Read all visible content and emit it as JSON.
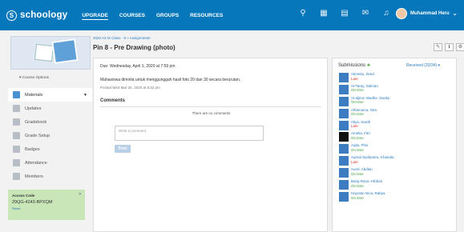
{
  "header": {
    "logo_text": "schoology",
    "logo_mark": "S",
    "nav": [
      "UPGRADE",
      "COURSES",
      "GROUPS",
      "RESOURCES"
    ],
    "icons": [
      "search-icon",
      "apps-grid-icon",
      "calendar-icon",
      "mail-icon",
      "bell-icon"
    ],
    "user_name": "Muhammad Heru",
    "brand_color": "#0677ba"
  },
  "sidebar": {
    "course_options": "▾ Course Options",
    "items": [
      {
        "label": "Materials",
        "icon": "materials-icon",
        "selected": true
      },
      {
        "label": "Updates",
        "icon": "updates-icon"
      },
      {
        "label": "Gradebook",
        "icon": "gradebook-icon"
      },
      {
        "label": "Grade Setup",
        "icon": "grade-setup-icon"
      },
      {
        "label": "Badges",
        "icon": "badges-icon"
      },
      {
        "label": "Attendance",
        "icon": "attendance-icon"
      },
      {
        "label": "Members",
        "icon": "members-icon"
      }
    ],
    "access_code": {
      "title": "Access Code",
      "code": "29QG-4243-BPXQM",
      "reset": "Reset"
    }
  },
  "breadcrumb": "2020 A3 IX Class · 8 » Assignments",
  "page_title": "Pin 8 - Pre Drawing (photo)",
  "assignment": {
    "due": "Due: Wednesday, April 1, 2020 at 7:59 pm",
    "instructions": "Mahasiswa diminta untuk menggunggah hasil foto 20 dan 30 secara berurutan.",
    "posted": "Posted Wed Mar 25, 2020 at 8:42 pm",
    "comments_heading": "Comments",
    "no_comments": "There are no comments",
    "comment_placeholder": "Write a comment",
    "post_label": "Post"
  },
  "submissions": {
    "heading": "Submissions",
    "filter": "Received (20/34) ▾",
    "items": [
      {
        "name": "Akmelia, Zeed",
        "status": "Late",
        "late": true
      },
      {
        "name": "Al-Taray, Salman",
        "status": "On time",
        "late": false
      },
      {
        "name": "Al-aljirun Wudhe, Deaky",
        "status": "On time",
        "late": false
      },
      {
        "name": "Alhamuinu, Stra",
        "status": "On time",
        "late": false
      },
      {
        "name": "Aliya, Sarah",
        "status": "Late",
        "late": true
      },
      {
        "name": "Amelia, Fitri",
        "status": "On time",
        "late": false
      },
      {
        "name": "Aqila, Phis",
        "status": "On time",
        "late": false
      },
      {
        "name": "Aqmal Syahputra, Khairala",
        "status": "Late",
        "late": true
      },
      {
        "name": "Aurel, Abdlan",
        "status": "On time",
        "late": false
      },
      {
        "name": "Barig Rana, Hibban",
        "status": "On time",
        "late": false
      },
      {
        "name": "Hayotan Nica, Rabya",
        "status": "On time",
        "late": false
      }
    ]
  }
}
